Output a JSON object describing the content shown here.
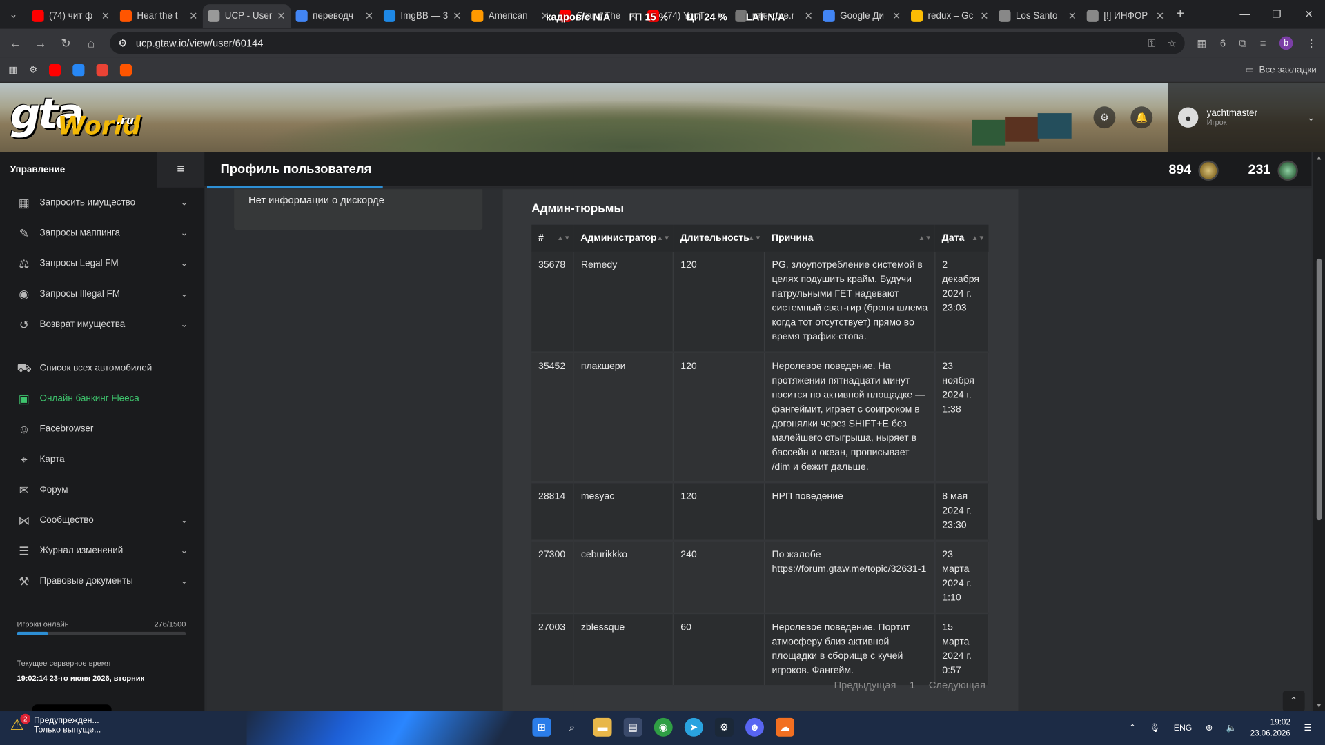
{
  "browser": {
    "tabs": [
      {
        "title": "(74) чит ф",
        "color": "#ff0000"
      },
      {
        "title": "Hear the t",
        "color": "#ff5500"
      },
      {
        "title": "UCP - User",
        "color": "#999999",
        "active": true
      },
      {
        "title": "переводч",
        "color": "#4285f4"
      },
      {
        "title": "ImgBB — 3",
        "color": "#1e88e5"
      },
      {
        "title": "American",
        "color": "#ff9900"
      },
      {
        "title": "Grand The",
        "color": "#ff0000"
      },
      {
        "title": "(74) YouT",
        "color": "#ff0000"
      },
      {
        "title": "retexture.r",
        "color": "#777777"
      },
      {
        "title": "Google Ди",
        "color": "#4285f4"
      },
      {
        "title": "redux – Gc",
        "color": "#fbbc04"
      },
      {
        "title": "Los Santo",
        "color": "#888888"
      },
      {
        "title": "[!] ИНФОР",
        "color": "#888888"
      }
    ],
    "overlay": {
      "fps_label": "кадров/с",
      "fps_value": "N/A",
      "gpu_label": "ГП",
      "gpu_value": "15 %",
      "cpu_label": "ЦП",
      "cpu_value": "24 %",
      "lat_label": "LAT",
      "lat_value": "N/A"
    },
    "url": "ucp.gtaw.io/view/user/60144",
    "ext_count": "6",
    "profile_letter": "b",
    "all_bookmarks": "Все закладки"
  },
  "site": {
    "logo_gta": "gta",
    "logo_world": "World",
    "logo_ru": ".ru",
    "user": {
      "name": "yachtmaster",
      "role": "Игрок"
    }
  },
  "sidebar": {
    "heading": "Управление",
    "items": [
      {
        "label": "Запросить имущество",
        "icon": "building-icon",
        "glyph": "▦",
        "expand": true
      },
      {
        "label": "Запросы маппинга",
        "icon": "brush-icon",
        "glyph": "✎",
        "expand": true
      },
      {
        "label": "Запросы Legal FM",
        "icon": "scales-icon",
        "glyph": "⚖",
        "expand": true
      },
      {
        "label": "Запросы Illegal FM",
        "icon": "mask-icon",
        "glyph": "◉",
        "expand": true
      },
      {
        "label": "Возврат имущества",
        "icon": "undo-icon",
        "glyph": "↺",
        "expand": true
      },
      {
        "label": "Список всех автомобилей",
        "icon": "car-icon",
        "glyph": "⛟",
        "expand": false,
        "gap": true
      },
      {
        "label": "Онлайн банкинг Fleeca",
        "icon": "money-icon",
        "glyph": "▣",
        "expand": false,
        "green": true
      },
      {
        "label": "Facebrowser",
        "icon": "users-icon",
        "glyph": "☺",
        "expand": false
      },
      {
        "label": "Карта",
        "icon": "map-icon",
        "glyph": "⌖",
        "expand": false
      },
      {
        "label": "Форум",
        "icon": "comments-icon",
        "glyph": "✉",
        "expand": false
      },
      {
        "label": "Сообщество",
        "icon": "share-icon",
        "glyph": "⋈",
        "expand": true
      },
      {
        "label": "Журнал изменений",
        "icon": "list-icon",
        "glyph": "☰",
        "expand": true
      },
      {
        "label": "Правовые документы",
        "icon": "gavel-icon",
        "glyph": "⚒",
        "expand": true
      }
    ],
    "online_label": "Игроки онлайн",
    "online_count": "276/1500",
    "online_fraction": 0.184,
    "time_label": "Текущее серверное время",
    "time_value": "19:02:14 23-го июня 2026, вторник"
  },
  "header": {
    "title": "Профиль пользователя",
    "counter1": "894",
    "counter2": "231"
  },
  "left_card": {
    "text": "Нет информации о дискорде"
  },
  "jail": {
    "title": "Админ-тюрьмы",
    "columns": [
      "#",
      "Администратор",
      "Длительность",
      "Причина",
      "Дата"
    ],
    "rows": [
      {
        "id": "35678",
        "admin": "Remedy",
        "duration": "120",
        "reason": "PG, злоупотребление системой в целях подушить крайм. Будучи патрульными ГЕТ надевают системный сват-гир (броня шлема когда тот отсутствует) прямо во время трафик-стопа.",
        "date": "2 декабря 2024 г. 23:03"
      },
      {
        "id": "35452",
        "admin": "плакшери",
        "duration": "120",
        "reason": "Неролевое поведение. На протяжении пятнадцати минут носится по активной площадке — фангеймит, играет с соигроком в догонялки через SHIFT+E без малейшего отыгрыша, ныряет в бассейн и океан, прописывает /dim и бежит дальше.",
        "date": "23 ноября 2024 г. 1:38"
      },
      {
        "id": "28814",
        "admin": "mesyac",
        "duration": "120",
        "reason": "НРП поведение",
        "date": "8 мая 2024 г. 23:30"
      },
      {
        "id": "27300",
        "admin": "ceburikkko",
        "duration": "240",
        "reason": "По жалобе https://forum.gtaw.me/topic/32631-1",
        "date": "23 марта 2024 г. 1:10"
      },
      {
        "id": "27003",
        "admin": "zblessque",
        "duration": "60",
        "reason": "Неролевое поведение. Портит атмосферу близ активной площадки в сборище с кучей игроков. Фангейм.",
        "date": "15 марта 2024 г. 0:57"
      }
    ],
    "pager": {
      "prev": "Предыдущая",
      "page": "1",
      "next": "Следующая"
    }
  },
  "taskbar": {
    "warn_count": "2",
    "warn_title": "Предупрежден...",
    "warn_sub": "Только выпуще...",
    "lang": "ENG",
    "time": "19:02",
    "date": "23.06.2026"
  }
}
